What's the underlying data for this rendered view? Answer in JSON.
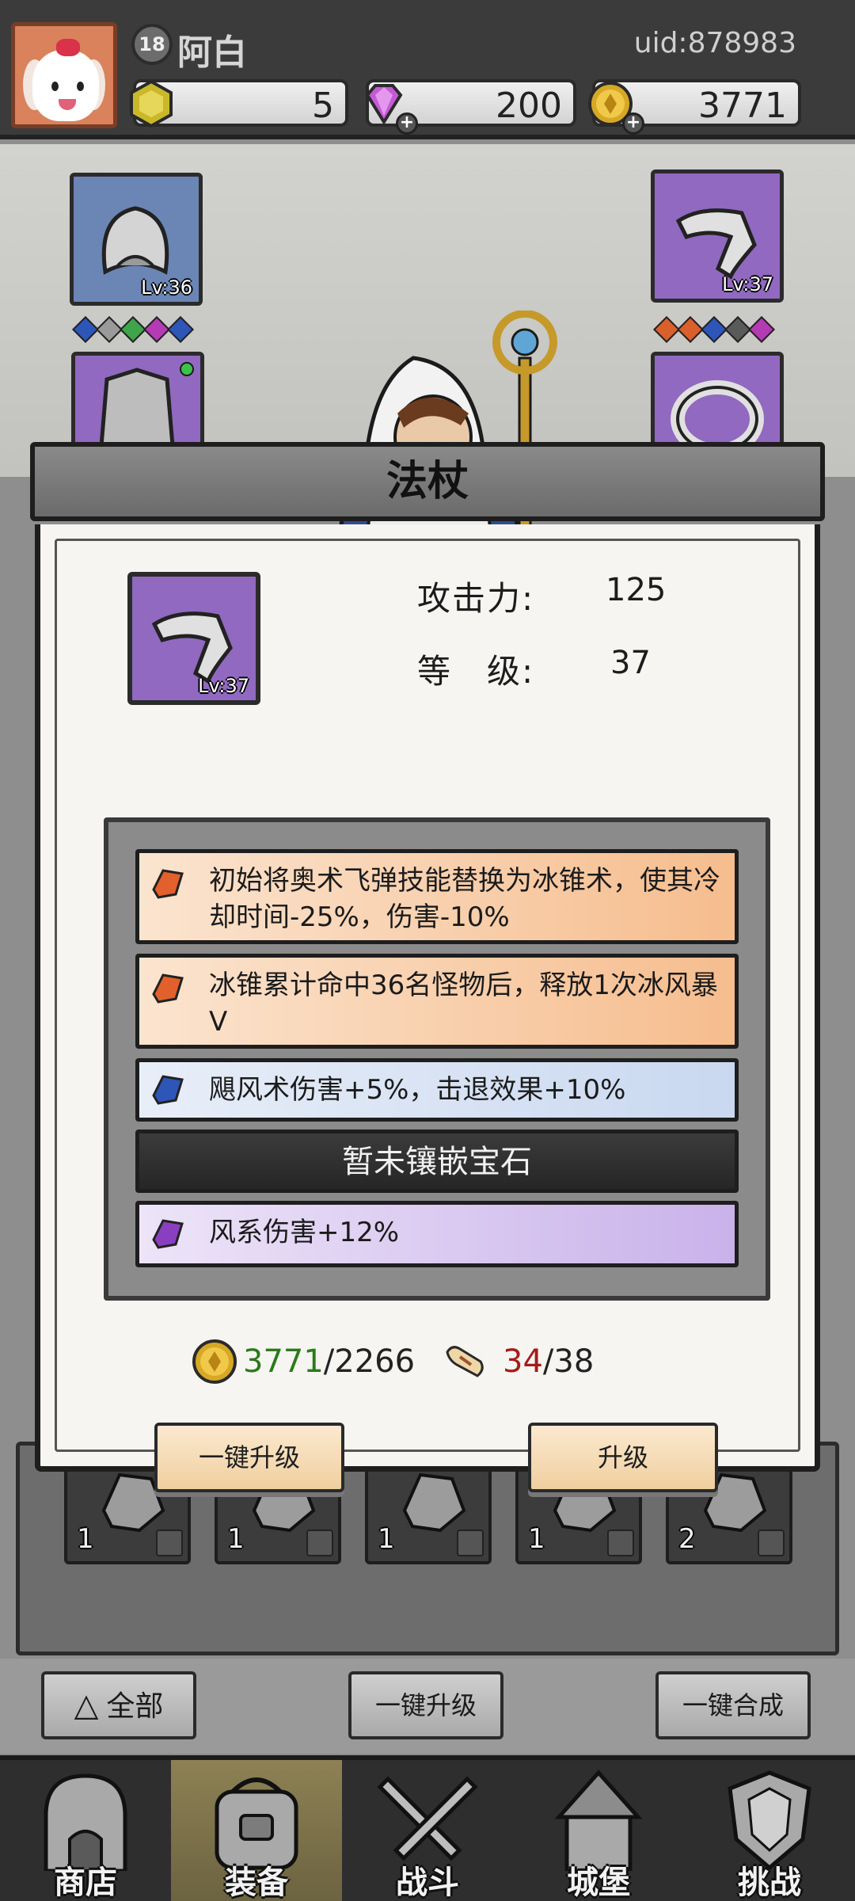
{
  "player": {
    "level": "18",
    "name": "阿白",
    "uid": "uid:878983"
  },
  "currencies": [
    {
      "name": "hexagon-token",
      "value": "5"
    },
    {
      "name": "diamond",
      "value": "200"
    },
    {
      "name": "gold-coin",
      "value": "3771"
    }
  ],
  "equipment": {
    "left_top": {
      "level": "Lv:36"
    },
    "right_top": {
      "level": "Lv:37"
    },
    "left_gems_colors": [
      "#2d56b8",
      "#9a9a9a",
      "#3fa54a",
      "#b43bb4",
      "#2d56b8"
    ],
    "right_gems_colors": [
      "#d9602b",
      "#d9602b",
      "#2d56b8",
      "#5a5a5a",
      "#b43bb4"
    ]
  },
  "dialog": {
    "title": "法杖",
    "item_level": "Lv:37",
    "stats": [
      {
        "label": "攻击力:",
        "value": "125"
      },
      {
        "label": "等　级:",
        "value": "37"
      }
    ],
    "affixes": [
      {
        "type": "orange",
        "text": "初始将奥术飞弹技能替换为冰锥术，使其冷却时间-25%，伤害-10%"
      },
      {
        "type": "orange",
        "text": "冰锥累计命中36名怪物后，释放1次冰风暴V"
      },
      {
        "type": "blue",
        "text": "飓风术伤害+5%，击退效果+10%"
      },
      {
        "type": "empty",
        "text": "暂未镶嵌宝石"
      },
      {
        "type": "purple",
        "text": "风系伤害+12%"
      }
    ],
    "cost_gold": {
      "have": "3771",
      "need": "/2266"
    },
    "cost_scroll": {
      "have": "34",
      "need": "/38"
    },
    "btn_auto_upgrade": "一键升级",
    "btn_upgrade": "升级"
  },
  "inventory": [
    {
      "count": "1"
    },
    {
      "count": "1"
    },
    {
      "count": "1"
    },
    {
      "count": "1"
    },
    {
      "count": "2"
    }
  ],
  "actions": {
    "all": "全部",
    "auto_upgrade": "一键升级",
    "auto_merge": "一键合成"
  },
  "nav": [
    {
      "label": "商店",
      "icon": "shop-icon"
    },
    {
      "label": "装备",
      "icon": "backpack-icon"
    },
    {
      "label": "战斗",
      "icon": "crossed-swords-icon"
    },
    {
      "label": "城堡",
      "icon": "castle-icon"
    },
    {
      "label": "挑战",
      "icon": "shield-icon"
    }
  ],
  "colors": {
    "purple_rarity": "#9169c0",
    "blue_rarity": "#6b86b5",
    "affix_orange": "#f6bd8e",
    "affix_blue": "#c9d8f0",
    "affix_purple": "#c9b2ea",
    "gold_have": "#2b7a1a",
    "scroll_have": "#a51b1b"
  }
}
